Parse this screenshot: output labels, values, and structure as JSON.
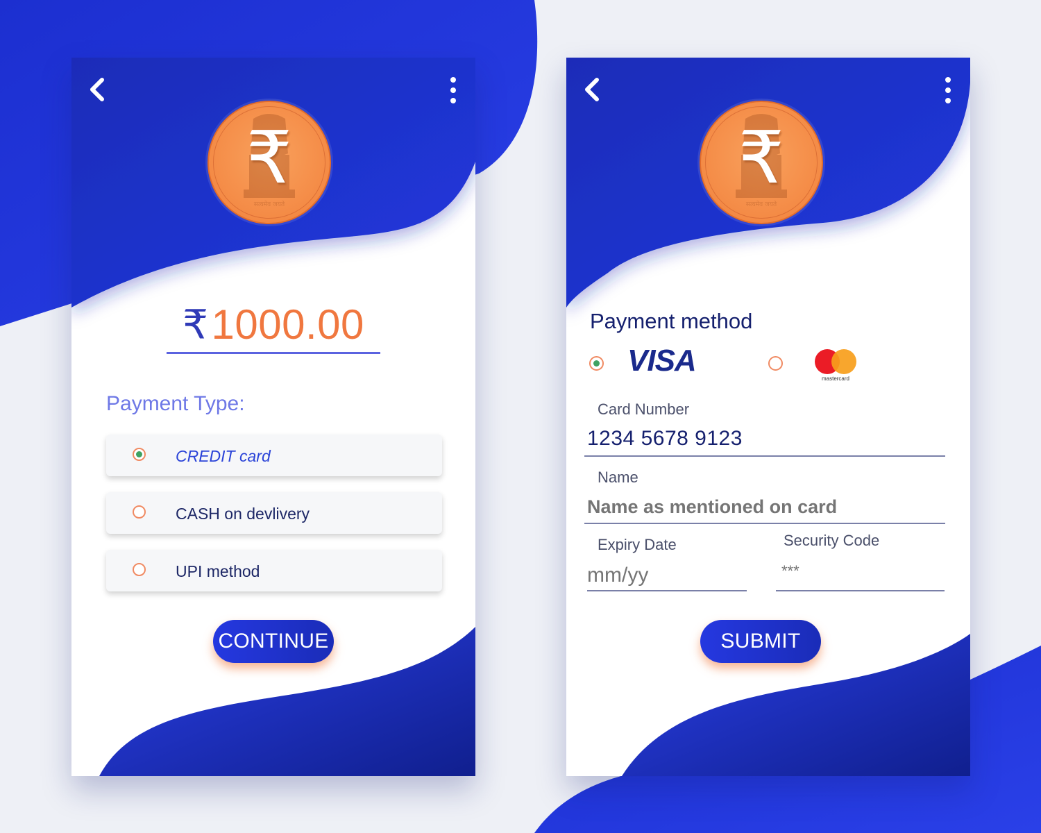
{
  "colors": {
    "brand_blue": "#1f33d6",
    "dark_blue": "#15206e",
    "accent_orange": "#f0773f",
    "radio_green": "#3fa262"
  },
  "left_screen": {
    "nav": {
      "back_icon": "chevron-left-icon",
      "menu_icon": "more-vertical-icon"
    },
    "logo": {
      "symbol": "₹",
      "emblem_text": "सत्यमेव जयते"
    },
    "amount": {
      "currency_symbol": "₹",
      "value": "1000.00"
    },
    "payment_type_label": "Payment Type:",
    "options": [
      {
        "label": "CREDIT card",
        "selected": true
      },
      {
        "label": "CASH on devlivery",
        "selected": false
      },
      {
        "label": "UPI method",
        "selected": false
      }
    ],
    "continue_label": "CONTINUE"
  },
  "right_screen": {
    "nav": {
      "back_icon": "chevron-left-icon",
      "menu_icon": "more-vertical-icon"
    },
    "logo": {
      "symbol": "₹",
      "emblem_text": "सत्यमेव जयते"
    },
    "payment_method_title": "Payment method",
    "card_options": [
      {
        "brand": "VISA",
        "selected": true
      },
      {
        "brand": "mastercard",
        "selected": false
      }
    ],
    "card_number": {
      "label": "Card Number",
      "value": "1234 5678 9123"
    },
    "name": {
      "label": "Name",
      "placeholder": "Name as mentioned on card"
    },
    "expiry": {
      "label": "Expiry Date",
      "placeholder": "mm/yy"
    },
    "security": {
      "label": "Security Code",
      "placeholder": "***"
    },
    "submit_label": "SUBMIT"
  }
}
